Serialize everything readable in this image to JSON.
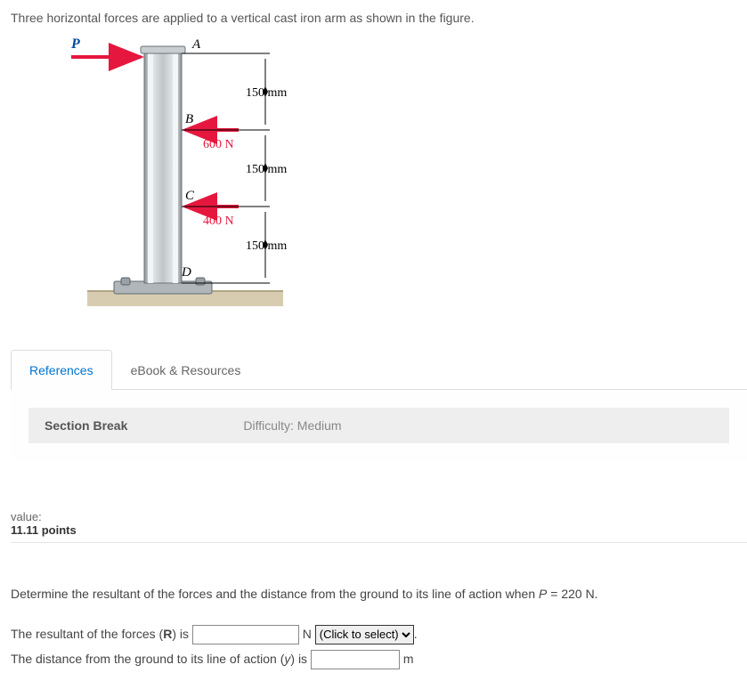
{
  "intro": "Three horizontal forces are applied to a vertical cast iron arm as shown in the figure.",
  "figure": {
    "labels": {
      "P": "P",
      "A": "A",
      "B": "B",
      "C": "C",
      "D": "D"
    },
    "dims": {
      "ab": "150 mm",
      "bc": "150 mm",
      "cd": "150 mm"
    },
    "forces": {
      "b": "600 N",
      "c": "400 N"
    }
  },
  "tabs": {
    "references": "References",
    "ebook": "eBook & Resources"
  },
  "section_break": {
    "label": "Section Break",
    "difficulty": "Difficulty: Medium"
  },
  "value": {
    "label": "value:",
    "points": "11.11 points"
  },
  "question": {
    "prompt_pre": "Determine the resultant of the forces and the distance from the ground to its line of action when ",
    "prompt_var": "P",
    "prompt_post": " = 220 N.",
    "line1_pre": "The resultant of the forces (",
    "line1_bold": "R",
    "line1_post": ")  is ",
    "unit_n": " N ",
    "select_placeholder": "(Click to select)",
    "line1_end": ".",
    "line2_pre": "The distance from the ground to its line of action (",
    "line2_var": "y",
    "line2_post": ") is ",
    "unit_m": " m"
  }
}
